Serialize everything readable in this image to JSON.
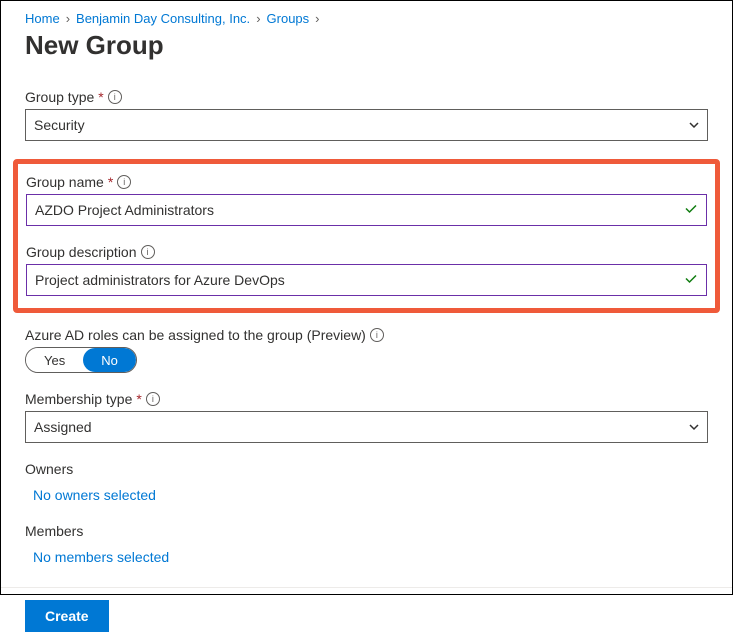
{
  "breadcrumb": {
    "home": "Home",
    "org": "Benjamin Day Consulting, Inc.",
    "groups": "Groups"
  },
  "page_title": "New Group",
  "fields": {
    "group_type": {
      "label": "Group type",
      "value": "Security"
    },
    "group_name": {
      "label": "Group name",
      "value": "AZDO Project Administrators"
    },
    "group_description": {
      "label": "Group description",
      "value": "Project administrators for Azure DevOps"
    },
    "aad_roles": {
      "label": "Azure AD roles can be assigned to the group (Preview)",
      "yes": "Yes",
      "no": "No",
      "selected": "No"
    },
    "membership_type": {
      "label": "Membership type",
      "value": "Assigned"
    }
  },
  "owners": {
    "label": "Owners",
    "status": "No owners selected"
  },
  "members": {
    "label": "Members",
    "status": "No members selected"
  },
  "actions": {
    "create": "Create"
  }
}
